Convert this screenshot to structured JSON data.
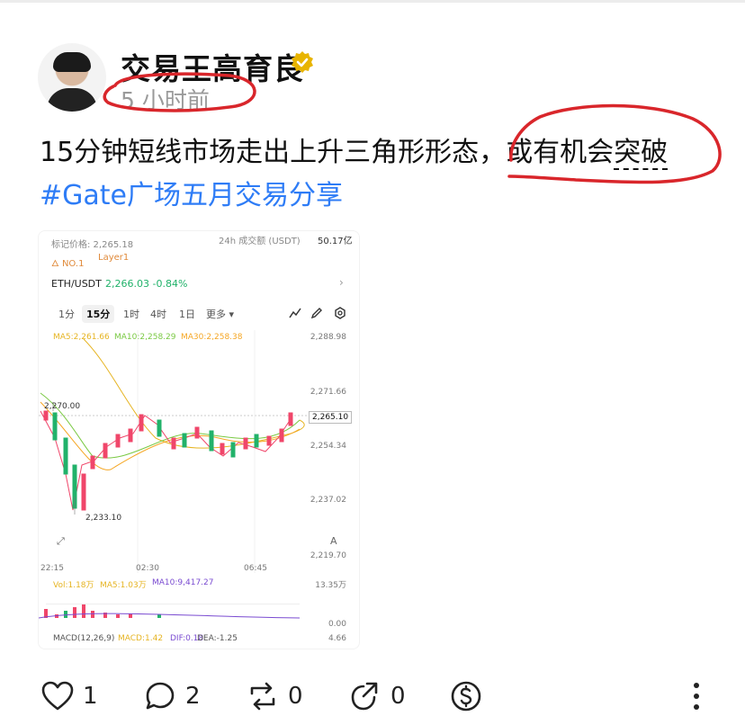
{
  "post": {
    "author": "交易王高育良",
    "time": "5 小时前",
    "text_a": "15分钟短线市场走出上升三角形形态，",
    "text_b": "或有机会",
    "text_c": "突破",
    "hashtag": "#Gate广场五月交易分享"
  },
  "card": {
    "mark_price": "标记价格: 2,265.18",
    "volume_24h": "24h 成交额 (USDT)",
    "volume_val": "50.17亿",
    "tag1": "NO.1",
    "tag2": "Layer1",
    "pair": "ETH/USDT",
    "pair_value": "2,266.03  -0.84%",
    "timeframes": [
      "1分",
      "15分",
      "1时",
      "4时",
      "1日",
      "更多 ▾"
    ],
    "ma5": "MA5:2,261.66",
    "ma10": "MA10:2,258.29",
    "ma30": "MA30:2,258.38",
    "y_ticks": [
      "2,288.98",
      "2,271.66",
      "2,254.34",
      "2,237.02",
      "2,219.70"
    ],
    "current_price": "2,265.10",
    "high_label": "2,270.00",
    "low_label": "2,233.10",
    "times": [
      "22:15",
      "02:30",
      "06:45"
    ],
    "vol": "Vol:1.18万",
    "vol_ma5": "MA5:1.03万",
    "vol_ma10": "MA10:9,417.27",
    "vol_top": "13.35万",
    "vol_zero": "0.00",
    "macd": "MACD(12,26,9)",
    "macd_val": "MACD:1.42",
    "dif": "DIF:0.18",
    "dea": "DEA:-1.25",
    "macd_right": "4.66",
    "colors": {
      "up": "#21b26a",
      "down": "#f0466a",
      "ma5": "#e6b422",
      "ma10": "#7ac943",
      "ma30": "#f5a623"
    }
  },
  "actions": {
    "likes": "1",
    "comments": "2",
    "reposts": "0",
    "shares": "0"
  },
  "colors": {
    "hashtag": "#2e7cf6",
    "annotation": "#d9262b",
    "verified": "#e8b400"
  }
}
